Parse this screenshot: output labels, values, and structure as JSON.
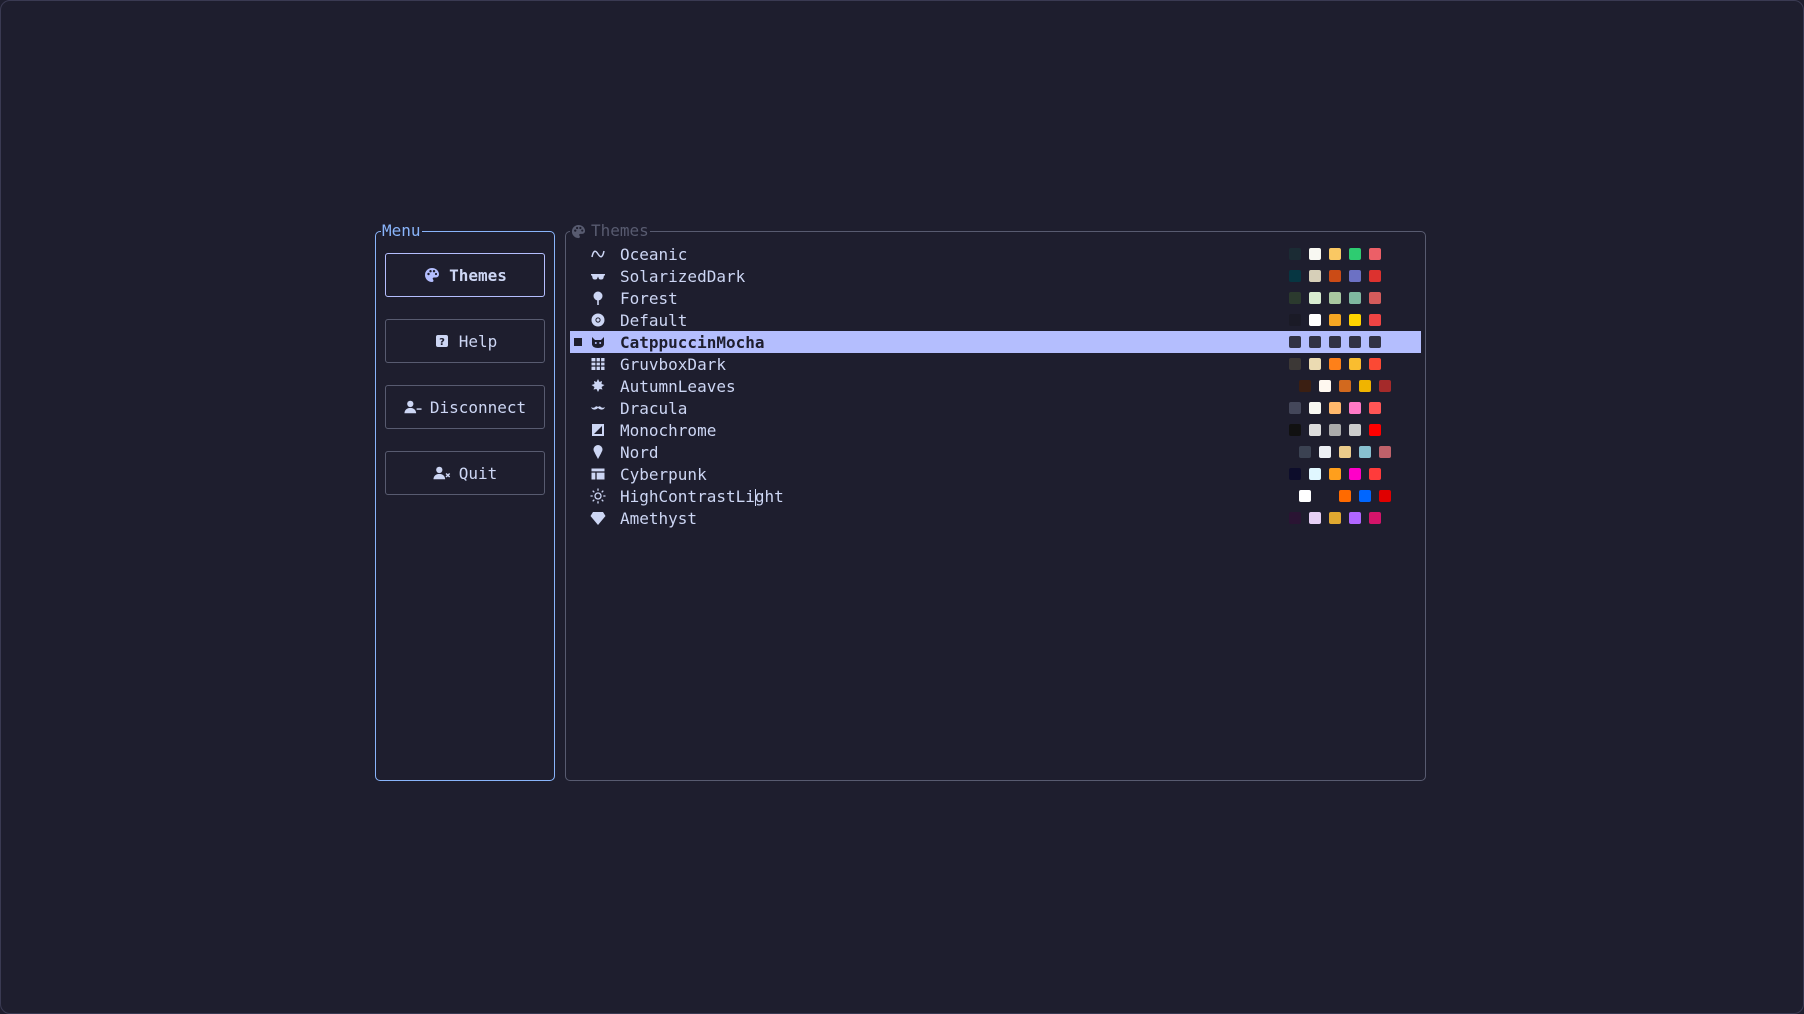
{
  "menu": {
    "title": "Menu",
    "buttons": [
      {
        "label": "Themes",
        "icon": "palette-icon",
        "active": true
      },
      {
        "label": "Help",
        "icon": "question-icon",
        "active": false
      },
      {
        "label": "Disconnect",
        "icon": "user-minus-icon",
        "active": false
      },
      {
        "label": "Quit",
        "icon": "user-x-icon",
        "active": false
      }
    ]
  },
  "themes": {
    "title": "Themes",
    "selected_index": 4,
    "items": [
      {
        "name": "Oceanic",
        "icon": "wave-icon",
        "swatches": [
          "#1b2b34",
          "#f8f8f2",
          "#fac863",
          "#2ecc71",
          "#ec5f67"
        ]
      },
      {
        "name": "SolarizedDark",
        "icon": "sunglasses-icon",
        "swatches": [
          "#073642",
          "#d6cfb8",
          "#cb4b16",
          "#6c71c4",
          "#dc322f"
        ]
      },
      {
        "name": "Forest",
        "icon": "tree-icon",
        "swatches": [
          "#2b3a2e",
          "#d8ecd0",
          "#a8c7a0",
          "#7fb8a0",
          "#d45b5b"
        ]
      },
      {
        "name": "Default",
        "icon": "chrome-icon",
        "swatches": [
          "#1a1a26",
          "#ffffff",
          "#f5a623",
          "#ffd400",
          "#ef4444"
        ]
      },
      {
        "name": "CatppuccinMocha",
        "icon": "cat-icon",
        "swatches": [
          "#313244",
          "#313244",
          "#313244",
          "#313244",
          "#313244"
        ]
      },
      {
        "name": "GruvboxDark",
        "icon": "grid-icon",
        "swatches": [
          "#3c3836",
          "#ebdbb2",
          "#fe8019",
          "#fabd2f",
          "#fb4934"
        ]
      },
      {
        "name": "AutumnLeaves",
        "icon": "leaf-icon",
        "swatches": [
          "#3b1f12",
          "#fff8f0",
          "#d2691e",
          "#f0b400",
          "#a52a2a"
        ]
      },
      {
        "name": "Dracula",
        "icon": "mustache-icon",
        "swatches": [
          "#44475a",
          "#f8f8f2",
          "#ffb86c",
          "#ff79c6",
          "#ff5555"
        ]
      },
      {
        "name": "Monochrome",
        "icon": "contrast-box-icon",
        "swatches": [
          "#111111",
          "#dddddd",
          "#aaaaaa",
          "#cccccc",
          "#ff0000"
        ]
      },
      {
        "name": "Nord",
        "icon": "ice-cream-icon",
        "swatches": [
          "#3b4252",
          "#eceff4",
          "#ebcb8b",
          "#88c0d0",
          "#bf616a"
        ]
      },
      {
        "name": "Cyberpunk",
        "icon": "panel-icon",
        "swatches": [
          "#0d0d2b",
          "#e0f7ff",
          "#ff9f1c",
          "#ff00c8",
          "#ff3b3b"
        ]
      },
      {
        "name": "HighContrastLight",
        "icon": "sun-icon",
        "swatches": [
          "#ffffff",
          "#1e1e2e",
          "#ff6a00",
          "#0066ff",
          "#e00000"
        ]
      },
      {
        "name": "Amethyst",
        "icon": "gem-icon",
        "swatches": [
          "#2a1433",
          "#e6d0f5",
          "#e0a830",
          "#b066ff",
          "#d4146a"
        ]
      }
    ]
  }
}
